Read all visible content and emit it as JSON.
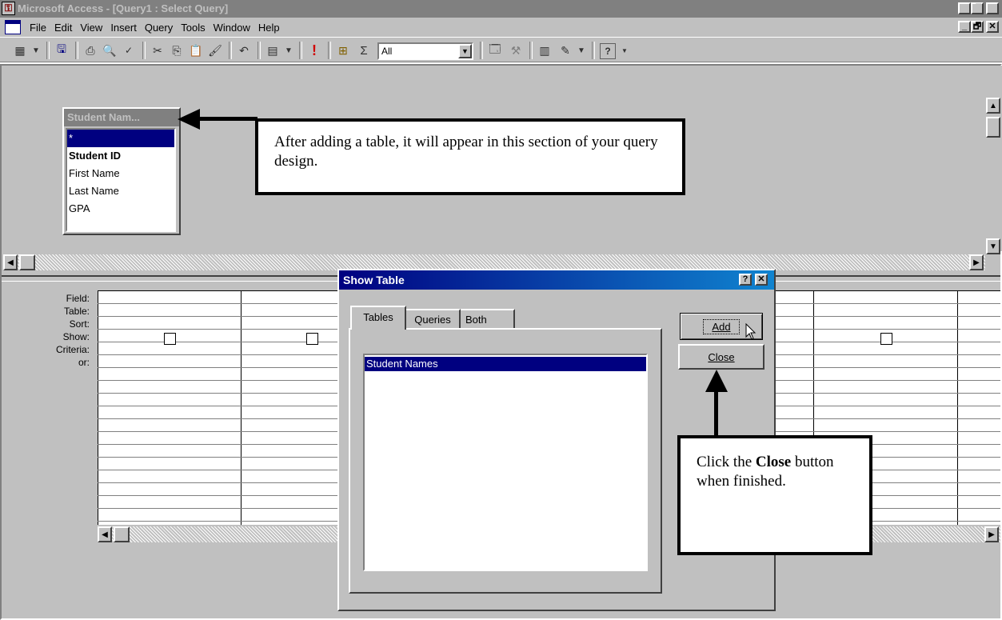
{
  "window": {
    "title": "Microsoft Access - [Query1 : Select Query]",
    "controls": [
      "_",
      "🗗",
      "✕"
    ]
  },
  "menu": [
    "File",
    "Edit",
    "View",
    "Insert",
    "Query",
    "Tools",
    "Window",
    "Help"
  ],
  "toolbar": {
    "top_values": "All"
  },
  "table_box": {
    "title": "Student Nam...",
    "fields": [
      "*",
      "Student ID",
      "First Name",
      "Last Name",
      "GPA"
    ]
  },
  "grid": {
    "row_labels": [
      "Field:",
      "Table:",
      "Sort:",
      "Show:",
      "Criteria:",
      "or:"
    ]
  },
  "dialog": {
    "title": "Show Table",
    "tabs": [
      "Tables",
      "Queries",
      "Both"
    ],
    "list_items": [
      "Student Names"
    ],
    "add_label": "Add",
    "close_label": "Close",
    "help_glyph": "?",
    "close_glyph": "✕"
  },
  "callouts": {
    "top_text": "After adding a table, it will appear in this section of your query design.",
    "bottom_pre": "Click the ",
    "bottom_bold": "Close",
    "bottom_post": " button when finished."
  },
  "colors": {
    "face": "#c0c0c0",
    "title_inactive": "#808080",
    "title_active": "#000080",
    "selection": "#000080"
  }
}
